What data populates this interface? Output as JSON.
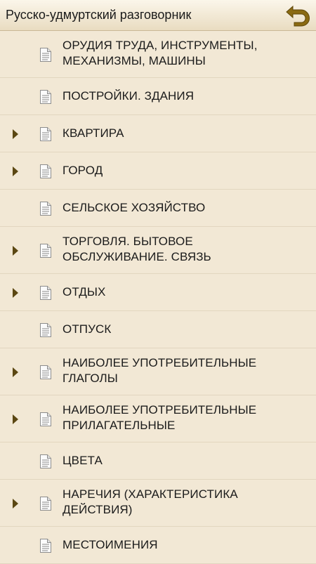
{
  "header": {
    "title": "Русско-удмуртский разговорник",
    "back_icon": "back-arrow-icon"
  },
  "items": [
    {
      "label": "ОРУДИЯ ТРУДА, ИНСТРУМЕНТЫ, МЕХАНИЗМЫ, МАШИНЫ",
      "has_children": false,
      "lines": 2
    },
    {
      "label": "ПОСТРОЙКИ. ЗДАНИЯ",
      "has_children": false,
      "lines": 1
    },
    {
      "label": "КВАРТИРА",
      "has_children": true,
      "lines": 1
    },
    {
      "label": "ГОРОД",
      "has_children": true,
      "lines": 1
    },
    {
      "label": "СЕЛЬСКОЕ ХОЗЯЙСТВО",
      "has_children": false,
      "lines": 1
    },
    {
      "label": "ТОРГОВЛЯ. БЫТОВОЕ ОБСЛУЖИВАНИЕ. СВЯЗЬ",
      "has_children": true,
      "lines": 2
    },
    {
      "label": "ОТДЫХ",
      "has_children": true,
      "lines": 1
    },
    {
      "label": "ОТПУСК",
      "has_children": false,
      "lines": 1
    },
    {
      "label": "НАИБОЛЕЕ УПОТРЕБИТЕЛЬНЫЕ ГЛАГОЛЫ",
      "has_children": true,
      "lines": 2
    },
    {
      "label": "НАИБОЛЕЕ УПОТРЕБИТЕЛЬНЫЕ ПРИЛАГАТЕЛЬНЫЕ",
      "has_children": true,
      "lines": 2
    },
    {
      "label": "ЦВЕТА",
      "has_children": false,
      "lines": 1
    },
    {
      "label": "НАРЕЧИЯ (ХАРАКТЕРИСТИКА ДЕЙСТВИЯ)",
      "has_children": true,
      "lines": 2
    },
    {
      "label": "МЕСТОИМЕНИЯ",
      "has_children": false,
      "lines": 1
    }
  ],
  "colors": {
    "background": "#f2e8d5",
    "arrow": "#5b4712",
    "back_icon": "#8a6a12"
  }
}
